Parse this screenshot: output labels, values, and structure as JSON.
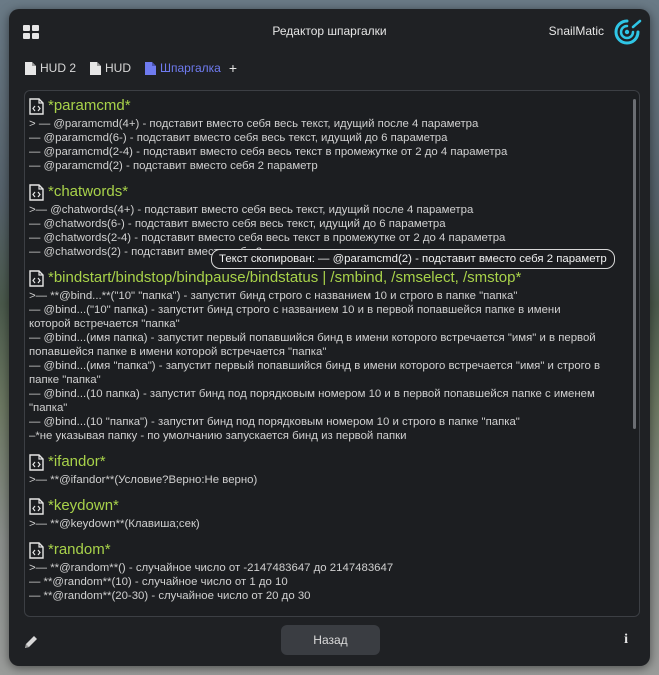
{
  "window": {
    "title": "Редактор шпаргалки",
    "brand": "SnailMatic"
  },
  "tabs": [
    {
      "label": "HUD 2",
      "active": false
    },
    {
      "label": "HUD",
      "active": false
    },
    {
      "label": "Шпаргалка",
      "active": true
    }
  ],
  "tab_add": "+",
  "sections": [
    {
      "title": "*paramcmd*",
      "lines": [
        "> — @paramcmd(4+) - подставит вместо себя весь текст, идущий после 4 параметра",
        "— @paramcmd(6-) - подставит вместо себя весь текст, идущий до 6 параметра",
        "— @paramcmd(2-4) - подставит вместо себя весь текст в промежутке от 2 до 4 параметра",
        "— @paramcmd(2) - подставит вместо себя 2 параметр"
      ]
    },
    {
      "title": "*chatwords*",
      "lines": [
        ">— @chatwords(4+) - подставит вместо себя весь текст, идущий после 4 параметра",
        "— @chatwords(6-) - подставит вместо себя весь текст, идущий до 6 параметра",
        "— @chatwords(2-4) - подставит вместо себя весь текст в промежутке от 2 до 4 параметра",
        "— @chatwords(2) - подставит вместо себя 2 параметр"
      ]
    },
    {
      "title": "*bindstart/bindstop/bindpause/bindstatus | /smbind, /smselect, /smstop*",
      "lines": [
        ">— **@bind...**(\"10\" \"папка\") - запустит бинд строго с названием 10 и строго в папке \"папка\"",
        "— @bind...(\"10\" папка) - запустит бинд строго с названием 10 и в первой попавшейся папке в имени",
        "которой встречается \"папка\"",
        "— @bind...(имя папка) - запустит первый попавшийся бинд в имени которого встречается \"имя\" и в первой",
        "попавшейся папке в имени которой встречается \"папка\"",
        "— @bind...(имя \"папка\") - запустит первый попавшийся бинд в имени которого встречается \"имя\" и строго в",
        "папке \"папка\"",
        "— @bind...(10 папка) - запустит бинд под порядковым номером 10 и в первой попавшейся папке с именем",
        "\"папка\"",
        "— @bind...(10 \"папка\") - запустит бинд под порядковым номером 10 и строго в папке \"папка\"",
        "–*не указывая папку - по умолчанию запускается бинд из первой папки"
      ]
    },
    {
      "title": "*ifandor*",
      "lines": [
        ">— **@ifandor**(Условие?Верно:Не верно)"
      ]
    },
    {
      "title": " *keydown*",
      "lines": [
        ">— **@keydown**(Клавиша;сек)"
      ]
    },
    {
      "title": "*random*",
      "lines": [
        ">— **@random**() - случайное число от -2147483647 до 2147483647",
        "— **@random**(10) - случайное число от 1 до 10",
        "— **@random**(20-30) - случайное число от 20 до 30"
      ]
    }
  ],
  "tooltip": "Текст скопирован: — @paramcmd(2) - подставит вместо себя 2 параметр",
  "footer": {
    "back_label": "Назад",
    "info_label": "i"
  },
  "colors": {
    "accent": "#6f7bf0",
    "heading": "#a8d24a",
    "logo": "#2fc6e6"
  }
}
